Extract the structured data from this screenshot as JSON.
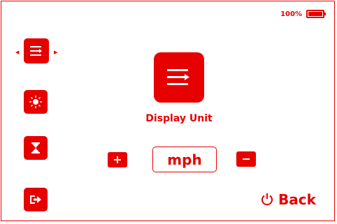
{
  "status": {
    "battery_percent": "100%",
    "battery_level": 1.0
  },
  "setting": {
    "title": "Display Unit",
    "value": "mph"
  },
  "back": {
    "label": "Back"
  },
  "colors": {
    "accent": "#e60000",
    "background": "#ffffff"
  },
  "icons": {
    "sidebar": [
      "menu-lines-icon",
      "brightness-sun-icon",
      "hourglass-icon",
      "exit-icon"
    ],
    "main": "menu-lines-icon",
    "back": "power-icon"
  }
}
